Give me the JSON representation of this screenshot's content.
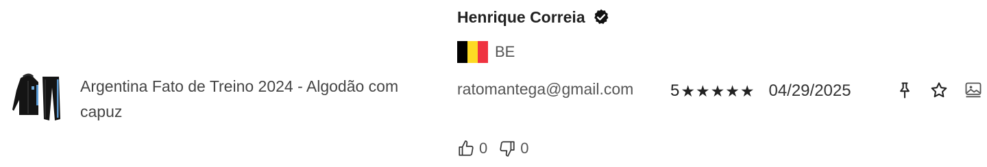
{
  "product": {
    "title": "Argentina Fato de Treino 2024 - Algodão com capuz",
    "thumbnail_icon": "tracksuit-image"
  },
  "reviewer": {
    "name": "Henrique Correia",
    "verified_icon": "verified-check-icon",
    "country_code": "BE",
    "flag_colors": [
      "#000000",
      "#FDDA24",
      "#EF3340"
    ],
    "email": "ratomantega@gmail.com"
  },
  "votes": {
    "likes": "0",
    "dislikes": "0"
  },
  "rating": {
    "value": "5",
    "stars": "★★★★★",
    "date": "04/29/2025"
  },
  "actions": [
    "pin-icon",
    "star-outline-icon",
    "image-icon"
  ]
}
